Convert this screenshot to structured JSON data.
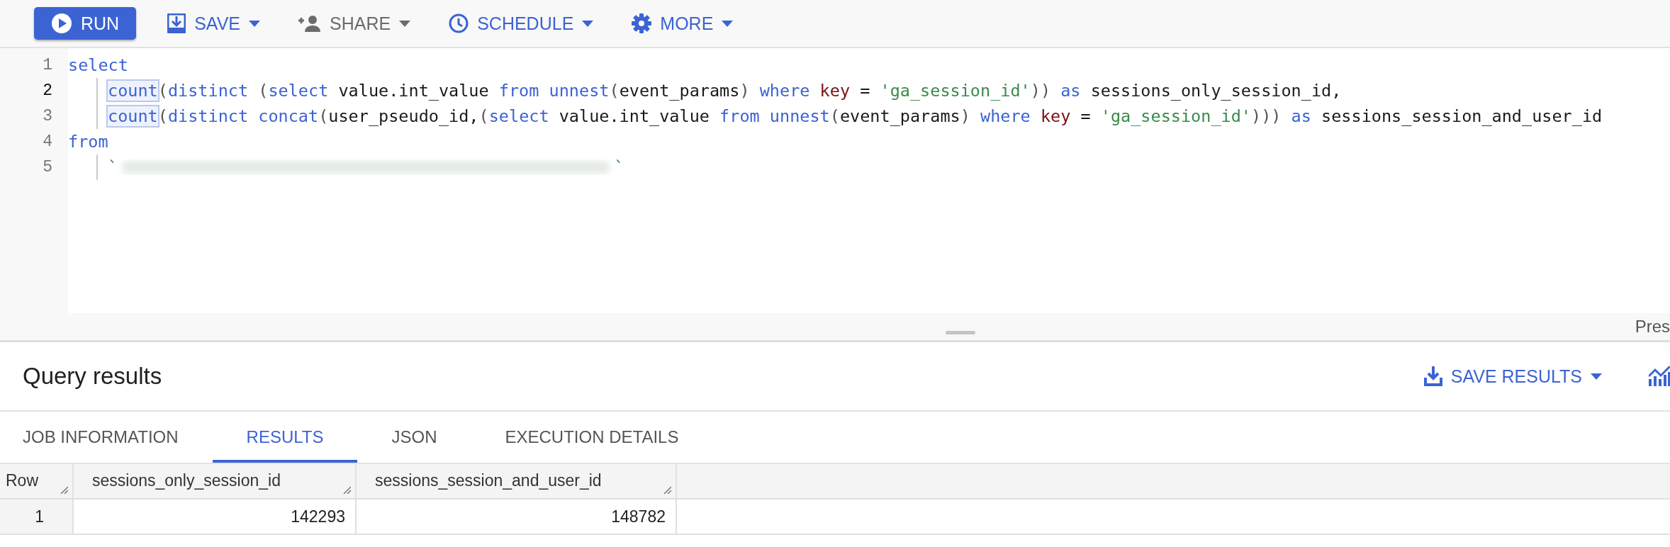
{
  "toolbar": {
    "buttons": [
      {
        "label": "RUN",
        "kind": "primary"
      },
      {
        "label": "SAVE",
        "kind": "menu",
        "disabled": false
      },
      {
        "label": "SHARE",
        "kind": "menu",
        "disabled": true
      },
      {
        "label": "SCHEDULE",
        "kind": "menu",
        "disabled": false
      },
      {
        "label": "MORE",
        "kind": "menu",
        "disabled": false
      }
    ]
  },
  "editor": {
    "lines": [
      {
        "number": "1",
        "active": false,
        "indent": false,
        "tokens": [
          {
            "kind": "keyword",
            "text": "select"
          }
        ]
      },
      {
        "number": "2",
        "active": true,
        "indent": true,
        "tokens": [
          {
            "kind": "keyword",
            "text": "count",
            "boxed": true
          },
          {
            "kind": "punct",
            "text": "("
          },
          {
            "kind": "keyword",
            "text": "distinct "
          },
          {
            "kind": "punct",
            "text": "("
          },
          {
            "kind": "keyword",
            "text": "select"
          },
          {
            "kind": "plain",
            "text": " value.int_value "
          },
          {
            "kind": "keyword",
            "text": "from unnest"
          },
          {
            "kind": "punct",
            "text": "("
          },
          {
            "kind": "plain",
            "text": "event_params"
          },
          {
            "kind": "punct",
            "text": ") "
          },
          {
            "kind": "keyword",
            "text": "where "
          },
          {
            "kind": "key",
            "text": "key"
          },
          {
            "kind": "plain",
            "text": " = "
          },
          {
            "kind": "string",
            "text": "'ga_session_id'"
          },
          {
            "kind": "punct",
            "text": ")) "
          },
          {
            "kind": "keyword",
            "text": "as"
          },
          {
            "kind": "plain",
            "text": " sessions_only_session_id,"
          }
        ]
      },
      {
        "number": "3",
        "active": false,
        "indent": true,
        "tokens": [
          {
            "kind": "keyword",
            "text": "count",
            "boxed": true
          },
          {
            "kind": "punct",
            "text": "("
          },
          {
            "kind": "keyword",
            "text": "distinct concat"
          },
          {
            "kind": "punct",
            "text": "("
          },
          {
            "kind": "plain",
            "text": "user_pseudo_id,"
          },
          {
            "kind": "punct",
            "text": "("
          },
          {
            "kind": "keyword",
            "text": "select"
          },
          {
            "kind": "plain",
            "text": " value.int_value "
          },
          {
            "kind": "keyword",
            "text": "from unnest"
          },
          {
            "kind": "punct",
            "text": "("
          },
          {
            "kind": "plain",
            "text": "event_params"
          },
          {
            "kind": "punct",
            "text": ") "
          },
          {
            "kind": "keyword",
            "text": "where "
          },
          {
            "kind": "key",
            "text": "key"
          },
          {
            "kind": "plain",
            "text": " = "
          },
          {
            "kind": "string",
            "text": "'ga_session_id'"
          },
          {
            "kind": "punct",
            "text": "))) "
          },
          {
            "kind": "keyword",
            "text": "as"
          },
          {
            "kind": "plain",
            "text": " sessions_session_and_user_id"
          }
        ]
      },
      {
        "number": "4",
        "active": false,
        "indent": false,
        "tokens": [
          {
            "kind": "keyword",
            "text": "from"
          }
        ]
      },
      {
        "number": "5",
        "active": false,
        "indent": true,
        "tokens": [
          {
            "kind": "string",
            "text": "`"
          },
          {
            "kind": "redacted"
          },
          {
            "kind": "string",
            "text": "`"
          }
        ]
      }
    ]
  },
  "status_hint": "Pres",
  "results": {
    "title": "Query results",
    "save_button": "SAVE RESULTS",
    "tabs": [
      {
        "label": "JOB INFORMATION",
        "selected": false
      },
      {
        "label": "RESULTS",
        "selected": true
      },
      {
        "label": "JSON",
        "selected": false
      },
      {
        "label": "EXECUTION DETAILS",
        "selected": false
      }
    ],
    "table": {
      "columns": [
        "Row",
        "sessions_only_session_id",
        "sessions_session_and_user_id"
      ],
      "rows": [
        [
          "1",
          "142293",
          "148782"
        ]
      ]
    }
  }
}
